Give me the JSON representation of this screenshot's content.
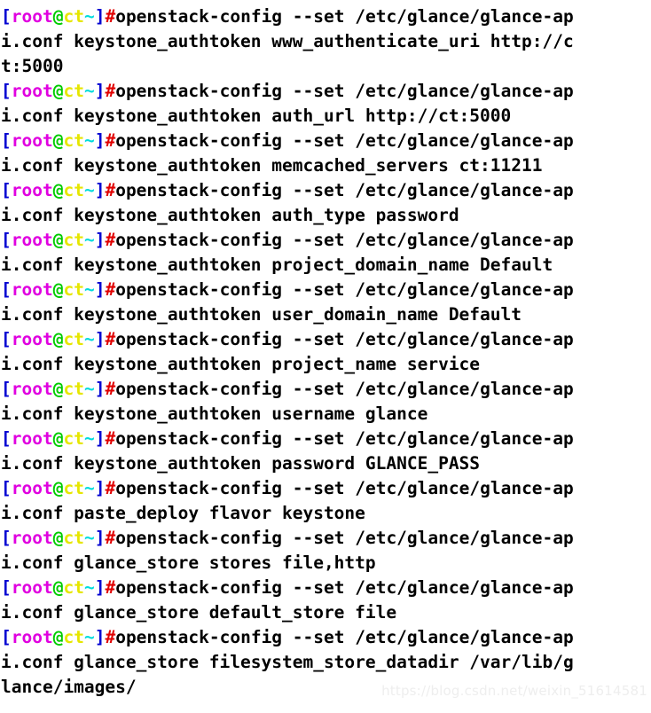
{
  "terminal": {
    "background_color": "#ffffff",
    "foreground_color": "#000000",
    "prompt": {
      "open_bracket": "[",
      "user": "root",
      "at": "@",
      "host": "ct",
      "tilde": "~",
      "close_bracket": "]",
      "hash": "#",
      "colors": {
        "bracket": "#0000d2",
        "user": "#e000e0",
        "at": "#00cc00",
        "host": "#e6e600",
        "tilde": "#00dcdc",
        "hash": "#e00000",
        "command": "#000000"
      }
    },
    "lines": [
      {
        "type": "prompt",
        "command": "openstack-config --set /etc/glance/glance-ap"
      },
      {
        "type": "output",
        "text": "i.conf keystone_authtoken www_authenticate_uri http://c"
      },
      {
        "type": "output",
        "text": "t:5000"
      },
      {
        "type": "prompt",
        "command": "openstack-config --set /etc/glance/glance-ap"
      },
      {
        "type": "output",
        "text": "i.conf keystone_authtoken auth_url http://ct:5000"
      },
      {
        "type": "prompt",
        "command": "openstack-config --set /etc/glance/glance-ap"
      },
      {
        "type": "output",
        "text": "i.conf keystone_authtoken memcached_servers ct:11211"
      },
      {
        "type": "prompt",
        "command": "openstack-config --set /etc/glance/glance-ap"
      },
      {
        "type": "output",
        "text": "i.conf keystone_authtoken auth_type password"
      },
      {
        "type": "prompt",
        "command": "openstack-config --set /etc/glance/glance-ap"
      },
      {
        "type": "output",
        "text": "i.conf keystone_authtoken project_domain_name Default"
      },
      {
        "type": "prompt",
        "command": "openstack-config --set /etc/glance/glance-ap"
      },
      {
        "type": "output",
        "text": "i.conf keystone_authtoken user_domain_name Default"
      },
      {
        "type": "prompt",
        "command": "openstack-config --set /etc/glance/glance-ap"
      },
      {
        "type": "output",
        "text": "i.conf keystone_authtoken project_name service"
      },
      {
        "type": "prompt",
        "command": "openstack-config --set /etc/glance/glance-ap"
      },
      {
        "type": "output",
        "text": "i.conf keystone_authtoken username glance"
      },
      {
        "type": "prompt",
        "command": "openstack-config --set /etc/glance/glance-ap"
      },
      {
        "type": "output",
        "text": "i.conf keystone_authtoken password GLANCE_PASS"
      },
      {
        "type": "prompt",
        "command": "openstack-config --set /etc/glance/glance-ap"
      },
      {
        "type": "output",
        "text": "i.conf paste_deploy flavor keystone"
      },
      {
        "type": "prompt",
        "command": "openstack-config --set /etc/glance/glance-ap"
      },
      {
        "type": "output",
        "text": "i.conf glance_store stores file,http"
      },
      {
        "type": "prompt",
        "command": "openstack-config --set /etc/glance/glance-ap"
      },
      {
        "type": "output",
        "text": "i.conf glance_store default_store file"
      },
      {
        "type": "prompt",
        "command": "openstack-config --set /etc/glance/glance-ap"
      },
      {
        "type": "output",
        "text": "i.conf glance_store filesystem_store_datadir /var/lib/g"
      },
      {
        "type": "output",
        "text": "lance/images/"
      }
    ]
  },
  "watermark": {
    "text": "https://blog.csdn.net/weixin_51614581"
  }
}
